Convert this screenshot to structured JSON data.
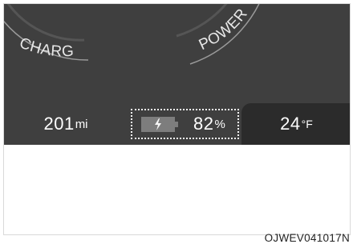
{
  "gauges": {
    "left_label": "CHARGE",
    "right_label": "POWER"
  },
  "range": {
    "value": "201",
    "unit": "mi"
  },
  "battery": {
    "icon": "charging-bolt-icon",
    "percent": "82",
    "unit": "%"
  },
  "temperature": {
    "value": "24",
    "unit": "°F"
  },
  "figure_code": "OJWEV041017N",
  "colors": {
    "panel": "#3f3f3f",
    "temp_panel": "#2b2b2b",
    "text": "#ffffff",
    "battery_fill": "#7d7d7d"
  }
}
